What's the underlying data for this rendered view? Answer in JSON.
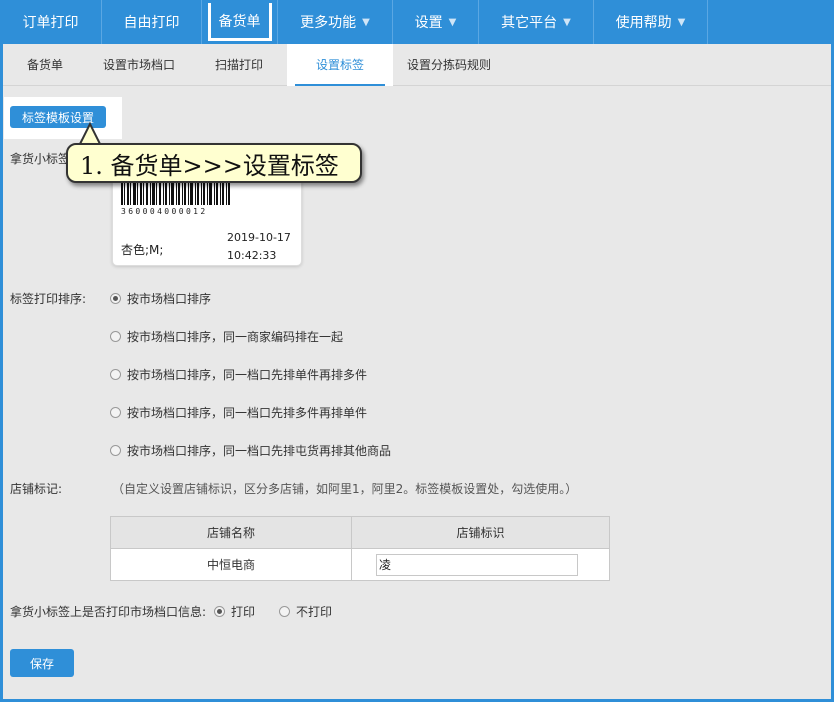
{
  "topnav": {
    "items": [
      {
        "label": "订单打印",
        "caret": false
      },
      {
        "label": "自由打印",
        "caret": false
      },
      {
        "label": "备货单",
        "caret": false,
        "active": true
      },
      {
        "label": "更多功能",
        "caret": true
      },
      {
        "label": "设置",
        "caret": true
      },
      {
        "label": "其它平台",
        "caret": true
      },
      {
        "label": "使用帮助",
        "caret": true
      }
    ],
    "caret_glyph": "▼"
  },
  "subnav": {
    "items": [
      {
        "label": "备货单"
      },
      {
        "label": "设置市场档口"
      },
      {
        "label": "扫描打印"
      },
      {
        "label": "设置标签",
        "active": true
      },
      {
        "label": "设置分拣码规则"
      }
    ]
  },
  "template_button": "标签模板设置",
  "label_preview": {
    "field_label": "拿货小标签",
    "barcode_number": "360004000012",
    "attributes": "杏色;M;",
    "date": "2019-10-17",
    "time": "10:42:33"
  },
  "tooltip": "1. 备货单>>>设置标签",
  "sort": {
    "label": "标签打印排序:",
    "options": [
      {
        "label": "按市场档口排序",
        "checked": true
      },
      {
        "label": "按市场档口排序，同一商家编码排在一起",
        "checked": false
      },
      {
        "label": "按市场档口排序，同一档口先排单件再排多件",
        "checked": false
      },
      {
        "label": "按市场档口排序，同一档口先排多件再排单件",
        "checked": false
      },
      {
        "label": "按市场档口排序，同一档口先排屯货再排其他商品",
        "checked": false
      }
    ]
  },
  "shop_mark": {
    "label": "店铺标记:",
    "hint": "（自定义设置店铺标识，区分多店铺，如阿里1，阿里2。标签模板设置处，勾选使用。）",
    "headers": [
      "店铺名称",
      "店铺标识"
    ],
    "rows": [
      {
        "name": "中恒电商",
        "mark": "凌"
      }
    ]
  },
  "print_market": {
    "label": "拿货小标签上是否打印市场档口信息:",
    "options": [
      {
        "label": "打印",
        "checked": true
      },
      {
        "label": "不打印",
        "checked": false
      }
    ]
  },
  "save_button": "保存",
  "colors": {
    "accent": "#2f8fd8",
    "tooltip_bg": "#ffffd0"
  }
}
